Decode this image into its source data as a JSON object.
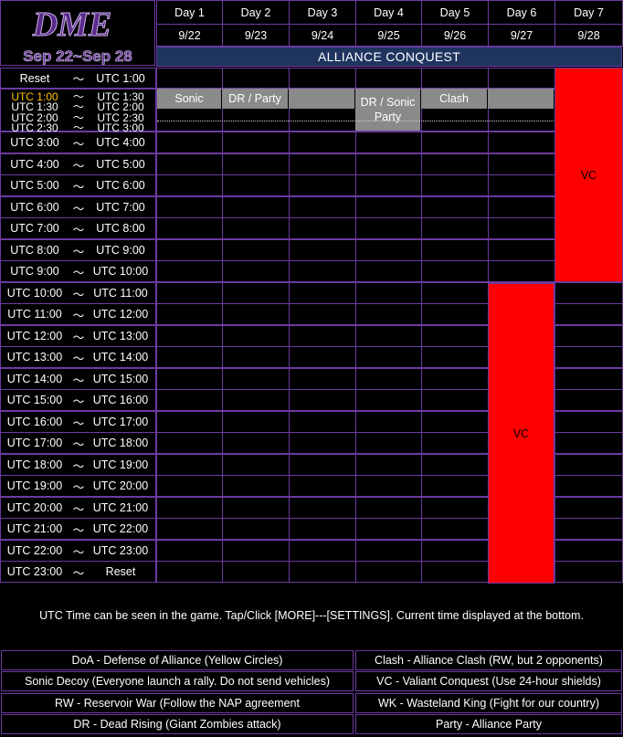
{
  "logo": {
    "text": "DME",
    "dates": "Sep 22~Sep 28"
  },
  "days": [
    {
      "label": "Day 1",
      "date": "9/22"
    },
    {
      "label": "Day 2",
      "date": "9/23"
    },
    {
      "label": "Day 3",
      "date": "9/24"
    },
    {
      "label": "Day 4",
      "date": "9/25"
    },
    {
      "label": "Day 5",
      "date": "9/26"
    },
    {
      "label": "Day 6",
      "date": "9/27"
    },
    {
      "label": "Day 7",
      "date": "9/28"
    }
  ],
  "title": "ALLIANCE CONQUEST",
  "tilde": "～",
  "time_rows": [
    {
      "start": "Reset",
      "end": "UTC 1:00"
    },
    {
      "start": "UTC 1:00",
      "end": "UTC 1:30",
      "sub": [
        {
          "start": "UTC 1:30",
          "end": "UTC 2:00"
        },
        {
          "start": "UTC 2:00",
          "end": "UTC 2:30"
        },
        {
          "start": "UTC 2:30",
          "end": "UTC 3:00"
        }
      ]
    },
    {
      "start": "UTC 3:00",
      "end": "UTC 4:00"
    },
    {
      "start": "UTC 4:00",
      "end": "UTC 5:00"
    },
    {
      "start": "UTC 5:00",
      "end": "UTC 6:00"
    },
    {
      "start": "UTC 6:00",
      "end": "UTC 7:00"
    },
    {
      "start": "UTC 7:00",
      "end": "UTC 8:00"
    },
    {
      "start": "UTC 8:00",
      "end": "UTC 9:00"
    },
    {
      "start": "UTC 9:00",
      "end": "UTC 10:00"
    },
    {
      "start": "UTC 10:00",
      "end": "UTC 11:00"
    },
    {
      "start": "UTC 11:00",
      "end": "UTC 12:00"
    },
    {
      "start": "UTC 12:00",
      "end": "UTC 13:00"
    },
    {
      "start": "UTC 13:00",
      "end": "UTC 14:00"
    },
    {
      "start": "UTC 14:00",
      "end": "UTC 15:00"
    },
    {
      "start": "UTC 15:00",
      "end": "UTC 16:00"
    },
    {
      "start": "UTC 16:00",
      "end": "UTC 17:00"
    },
    {
      "start": "UTC 17:00",
      "end": "UTC 18:00"
    },
    {
      "start": "UTC 18:00",
      "end": "UTC 19:00"
    },
    {
      "start": "UTC 19:00",
      "end": "UTC 20:00"
    },
    {
      "start": "UTC 20:00",
      "end": "UTC 21:00"
    },
    {
      "start": "UTC 21:00",
      "end": "UTC 22:00"
    },
    {
      "start": "UTC 22:00",
      "end": "UTC 23:00"
    },
    {
      "start": "UTC 23:00",
      "end": "Reset"
    }
  ],
  "events": {
    "day1": "Sonic",
    "day2": "DR / Party",
    "day4_line1": "DR / Sonic",
    "day4_line2": "Party",
    "day5": "Clash",
    "day6": "VC",
    "day7": "VC"
  },
  "colors": {
    "highlight": "#ffc000",
    "vc": "#ff0000",
    "event": "#8a8a8a",
    "title_bg": "#1f3560",
    "border": "#6b3aa0"
  },
  "note": "UTC Time can be seen in the game. Tap/Click [MORE]---[SETTINGS]. Current time displayed at the bottom.",
  "legend_left": [
    "DoA - Defense of Alliance (Yellow Circles)",
    "Sonic Decoy (Everyone launch a rally. Do not send vehicles)",
    "RW - Reservoir War (Follow the NAP agreement",
    "DR - Dead Rising (Giant Zombies attack)"
  ],
  "legend_right": [
    "Clash - Alliance Clash (RW, but 2 opponents)",
    "VC - Valiant Conquest (Use 24-hour shields)",
    "WK - Wasteland King (Fight for our country)",
    "Party - Alliance Party"
  ]
}
